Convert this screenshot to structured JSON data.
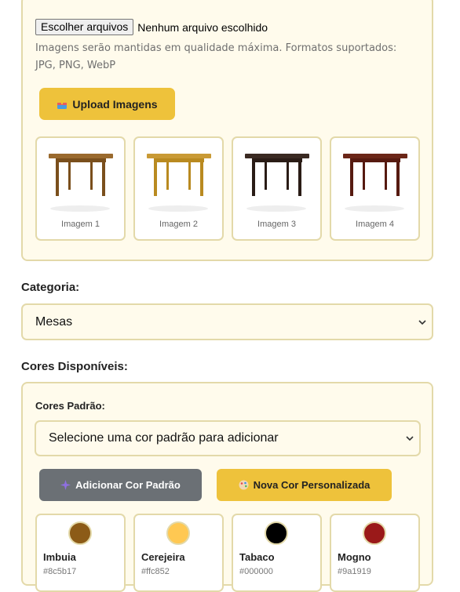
{
  "upload": {
    "file_button": "Escolher arquivos",
    "file_status": "Nenhum arquivo escolhido",
    "help_text": "Imagens serão mantidas em qualidade máxima. Formatos suportados: JPG, PNG, WebP",
    "upload_button": "Upload Imagens",
    "images": [
      {
        "label": "Imagem 1",
        "top": "#9a6a2e",
        "leg": "#7a4f1c"
      },
      {
        "label": "Imagem 2",
        "top": "#c99a35",
        "leg": "#b98a20"
      },
      {
        "label": "Imagem 3",
        "top": "#3a2a22",
        "leg": "#2a1c16"
      },
      {
        "label": "Imagem 4",
        "top": "#6b2618",
        "leg": "#561a10"
      }
    ]
  },
  "category": {
    "label": "Categoria:",
    "selected": "Mesas"
  },
  "colors": {
    "label": "Cores Disponíveis:",
    "default_label": "Cores Padrão:",
    "default_select_placeholder": "Selecione uma cor padrão para adicionar",
    "add_default_button": "Adicionar Cor Padrão",
    "new_custom_button": "Nova Cor Personalizada",
    "swatches": [
      {
        "name": "Imbuia",
        "hex": "#8c5b17"
      },
      {
        "name": "Cerejeira",
        "hex": "#ffc852"
      },
      {
        "name": "Tabaco",
        "hex": "#000000"
      },
      {
        "name": "Mogno",
        "hex": "#9a1919"
      }
    ]
  },
  "theme": {
    "accent": "#eec23b",
    "panel_bg": "#fffbec",
    "panel_border": "#e3d9a9",
    "gray_button": "#6b7075"
  }
}
